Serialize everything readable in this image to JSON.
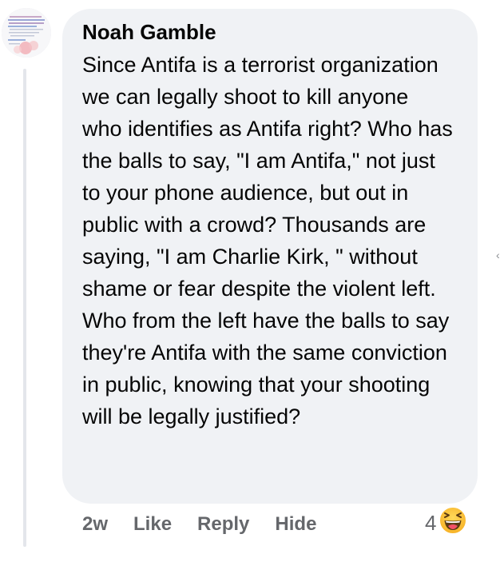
{
  "comment": {
    "author": "Noah Gamble",
    "text": "Since Antifa is a terrorist organization we can legally shoot to kill anyone who identifies as Antifa right? Who has the balls to say, \"I am Antifa,\" not just to your phone audience, but out in public with a crowd? Thousands are saying, \"I am Charlie Kirk, \" without shame or fear despite the violent left. Who from the left have the balls to say they're Antifa with the same conviction in public, knowing that your shooting will be legally justified?",
    "avatar_icon": "profile-picture"
  },
  "actions": {
    "time": "2w",
    "like_label": "Like",
    "reply_label": "Reply",
    "hide_label": "Hide"
  },
  "reactions": {
    "count": "4",
    "icon": "haha-reaction-icon"
  },
  "colors": {
    "bubble_bg": "#f0f2f5",
    "text": "#050505",
    "muted": "#65676b",
    "reaction_yellow": "#f7b125"
  }
}
